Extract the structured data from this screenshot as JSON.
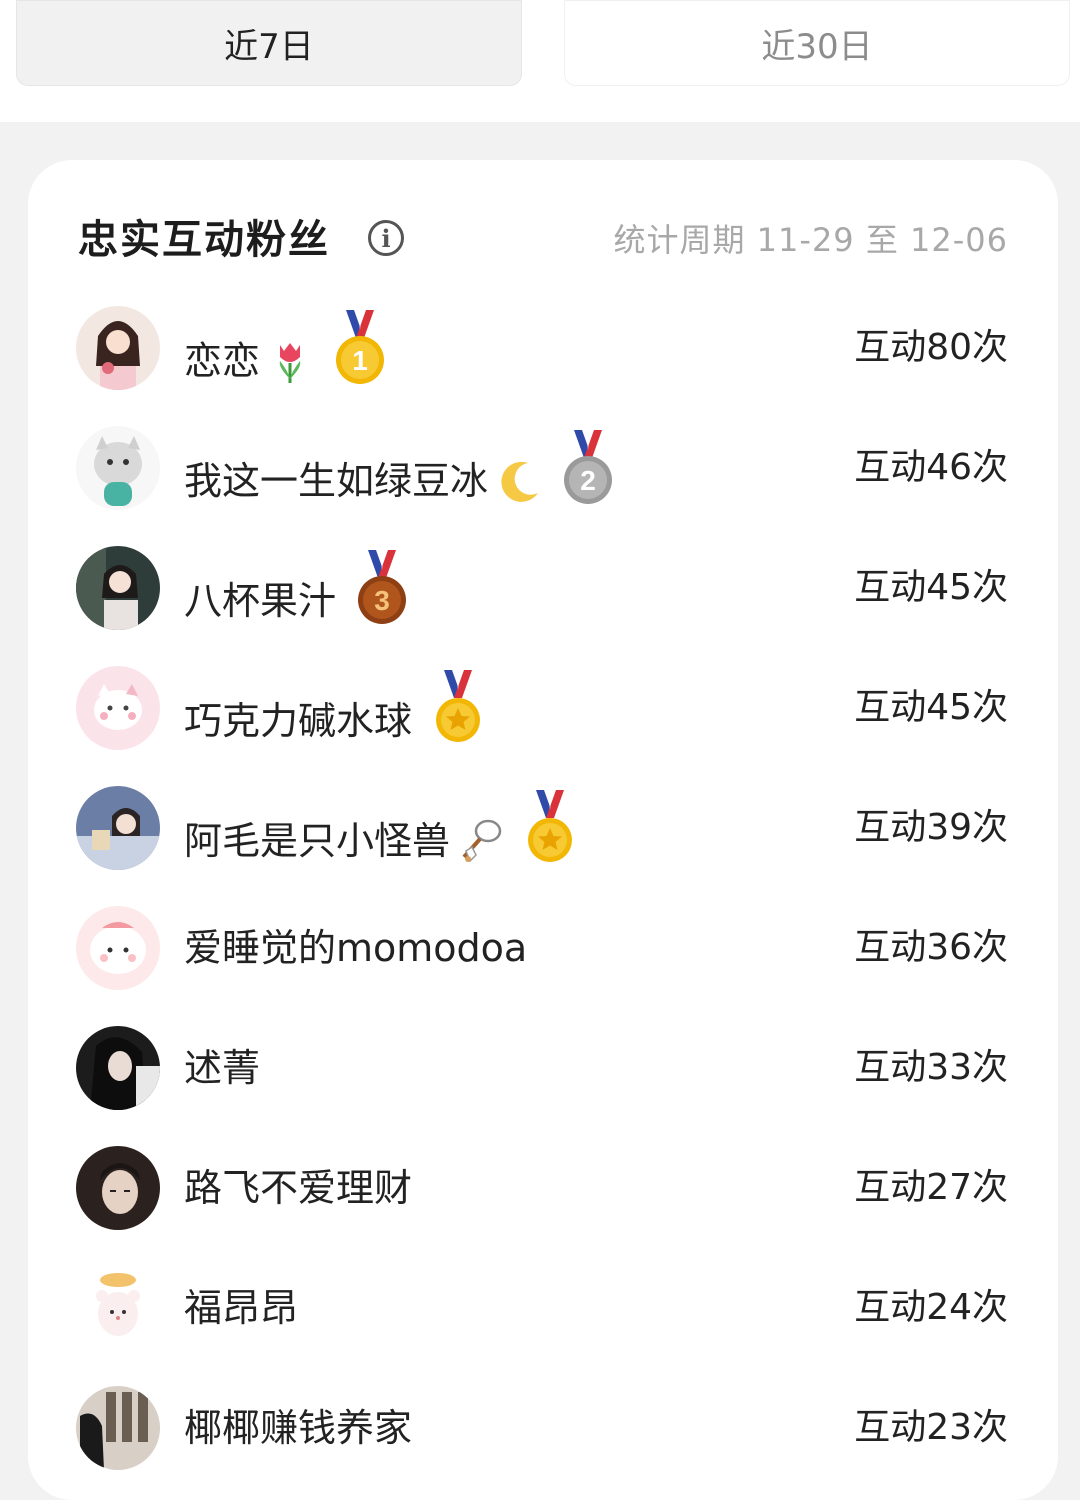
{
  "tabs": {
    "recent7": "近7日",
    "recent30": "近30日"
  },
  "card": {
    "title": "忠实互动粉丝",
    "info_icon": "info-icon",
    "period": "统计周期 11-29 至 12-06"
  },
  "fans": [
    {
      "name": "恋恋",
      "emoji": "tulip",
      "medal": "1",
      "count": "互动80次"
    },
    {
      "name": "我这一生如绿豆冰",
      "emoji": "crescent-moon",
      "medal": "2",
      "count": "互动46次"
    },
    {
      "name": "八杯果汁",
      "emoji": "",
      "medal": "3",
      "count": "互动45次"
    },
    {
      "name": "巧克力碱水球",
      "emoji": "",
      "medal": "star",
      "count": "互动45次"
    },
    {
      "name": "阿毛是只小怪兽",
      "emoji": "badminton",
      "medal": "star",
      "count": "互动39次"
    },
    {
      "name": "爱睡觉的momodoa",
      "emoji": "",
      "medal": "",
      "count": "互动36次"
    },
    {
      "name": "述菁",
      "emoji": "",
      "medal": "",
      "count": "互动33次"
    },
    {
      "name": "路飞不爱理财",
      "emoji": "",
      "medal": "",
      "count": "互动27次"
    },
    {
      "name": "福昂昂",
      "emoji": "",
      "medal": "",
      "count": "互动24次"
    },
    {
      "name": "椰椰赚钱养家",
      "emoji": "",
      "medal": "",
      "count": "互动23次"
    }
  ],
  "colors": {
    "medal_gold": "#f2b705",
    "medal_silver": "#9a9a9a",
    "medal_bronze": "#b0561c",
    "ribbon_blue": "#2f4aa8",
    "ribbon_red": "#d9323b"
  }
}
